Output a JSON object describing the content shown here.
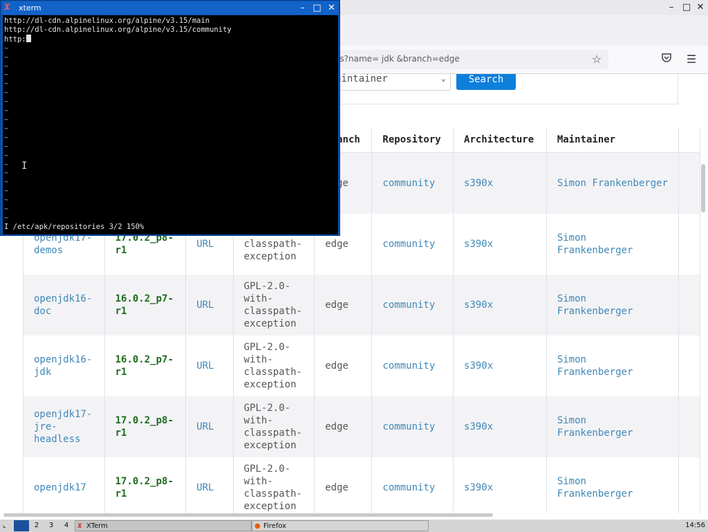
{
  "browser": {
    "url_fragment": "es?name=   jdk   &branch=edge",
    "window_controls": [
      "–",
      "□",
      "✕"
    ]
  },
  "search_form": {
    "field_value": "aintainer",
    "button_label": "Search"
  },
  "table": {
    "headers": [
      "Branch",
      "Repository",
      "Architecture",
      "Maintainer"
    ],
    "first_row_partial": {
      "branch": "edge",
      "repository": "community",
      "architecture": "s390x",
      "maintainer": "Simon Frankenberger"
    },
    "rows": [
      {
        "package": "openjdk17-demos",
        "package_display": "openjdk17-\ndemos",
        "version": "17.0.2_p8-\nr1",
        "url": "URL",
        "license": "with-\nclasspath-\nexception",
        "branch": "edge",
        "repository": "community",
        "architecture": "s390x",
        "maintainer": "Simon\nFrankenberger"
      },
      {
        "package": "openjdk16-doc",
        "package_display": "openjdk16-\ndoc",
        "version": "16.0.2_p7-\nr1",
        "url": "URL",
        "license": "GPL-2.0-\nwith-\nclasspath-\nexception",
        "branch": "edge",
        "repository": "community",
        "architecture": "s390x",
        "maintainer": "Simon\nFrankenberger"
      },
      {
        "package": "openjdk16-jdk",
        "package_display": "openjdk16-\njdk",
        "version": "16.0.2_p7-\nr1",
        "url": "URL",
        "license": "GPL-2.0-\nwith-\nclasspath-\nexception",
        "branch": "edge",
        "repository": "community",
        "architecture": "s390x",
        "maintainer": "Simon\nFrankenberger"
      },
      {
        "package": "openjdk17-jre-headless",
        "package_display": "openjdk17-\njre-\nheadless",
        "version": "17.0.2_p8-\nr1",
        "url": "URL",
        "license": "GPL-2.0-\nwith-\nclasspath-\nexception",
        "branch": "edge",
        "repository": "community",
        "architecture": "s390x",
        "maintainer": "Simon\nFrankenberger"
      },
      {
        "package": "openjdk17",
        "package_display": "openjdk17",
        "version": "17.0.2_p8-\nr1",
        "url": "URL",
        "license": "GPL-2.0-\nwith-\nclasspath-\nexception",
        "branch": "edge",
        "repository": "community",
        "architecture": "s390x",
        "maintainer": "Simon\nFrankenberger"
      }
    ]
  },
  "xterm": {
    "title": "xterm",
    "lines": [
      "http://dl-cdn.alpinelinux.org/alpine/v3.15/main",
      "http://dl-cdn.alpinelinux.org/alpine/v3.15/community",
      "http:"
    ],
    "tilde_count": 20,
    "status_line": "I /etc/apk/repositories 3/2 150%"
  },
  "taskbar": {
    "workspaces": [
      "1",
      "2",
      "3",
      "4"
    ],
    "tasks": [
      "XTerm",
      "Firefox"
    ],
    "clock": "14:56"
  }
}
